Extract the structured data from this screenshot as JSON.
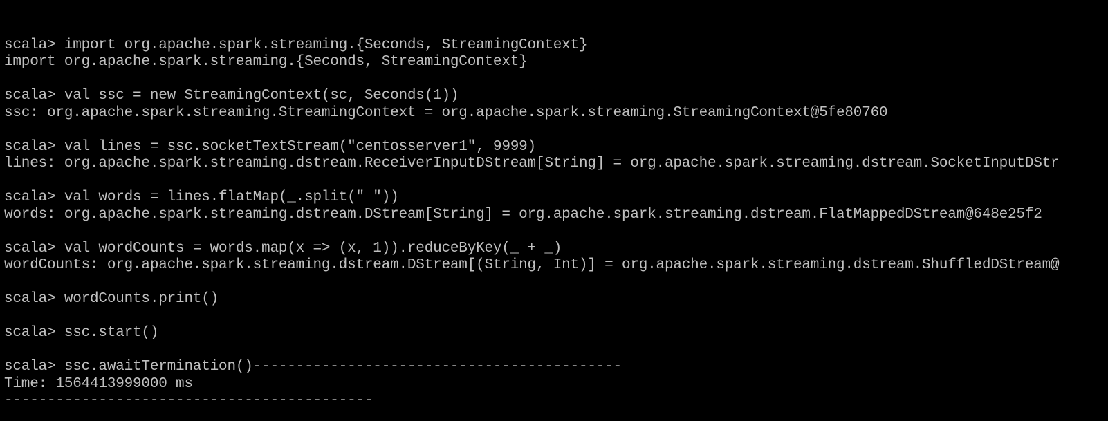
{
  "terminal": {
    "background": "#000000",
    "foreground": "#c0c0c0",
    "lines": [
      "",
      "scala> import org.apache.spark.streaming.{Seconds, StreamingContext}",
      "import org.apache.spark.streaming.{Seconds, StreamingContext}",
      "",
      "scala> val ssc = new StreamingContext(sc, Seconds(1))",
      "ssc: org.apache.spark.streaming.StreamingContext = org.apache.spark.streaming.StreamingContext@5fe80760",
      "",
      "scala> val lines = ssc.socketTextStream(\"centosserver1\", 9999)",
      "lines: org.apache.spark.streaming.dstream.ReceiverInputDStream[String] = org.apache.spark.streaming.dstream.SocketInputDStr",
      "",
      "scala> val words = lines.flatMap(_.split(\" \"))",
      "words: org.apache.spark.streaming.dstream.DStream[String] = org.apache.spark.streaming.dstream.FlatMappedDStream@648e25f2",
      "",
      "scala> val wordCounts = words.map(x => (x, 1)).reduceByKey(_ + _)",
      "wordCounts: org.apache.spark.streaming.dstream.DStream[(String, Int)] = org.apache.spark.streaming.dstream.ShuffledDStream@",
      "",
      "scala> wordCounts.print()",
      "",
      "scala> ssc.start()",
      "",
      "scala> ssc.awaitTermination()-------------------------------------------",
      "Time: 1564413999000 ms",
      "-------------------------------------------"
    ]
  }
}
